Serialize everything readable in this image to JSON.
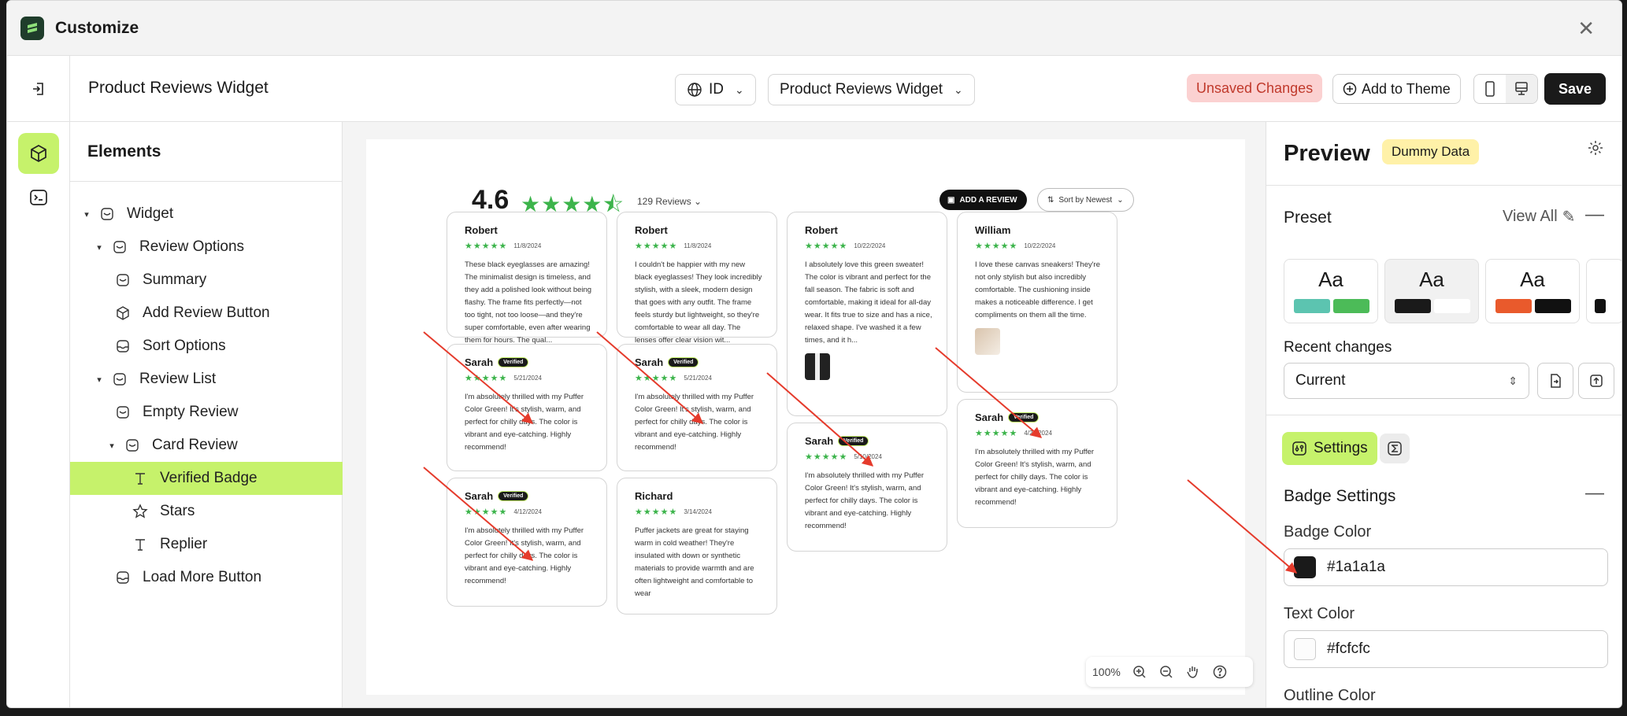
{
  "app": {
    "title": "Customize"
  },
  "toolbar": {
    "page_name": "Product Reviews Widget",
    "language": "ID",
    "widget_select": "Product Reviews Widget",
    "unsaved": "Unsaved Changes",
    "add_to_theme": "Add to Theme",
    "save": "Save"
  },
  "elements": {
    "title": "Elements",
    "tree": [
      {
        "label": "Widget"
      },
      {
        "label": "Review Options"
      },
      {
        "label": "Summary"
      },
      {
        "label": "Add Review Button"
      },
      {
        "label": "Sort Options"
      },
      {
        "label": "Review List"
      },
      {
        "label": "Empty Review"
      },
      {
        "label": "Card Review"
      },
      {
        "label": "Verified Badge"
      },
      {
        "label": "Stars"
      },
      {
        "label": "Replier"
      },
      {
        "label": "Load More Button"
      }
    ]
  },
  "canvas": {
    "rating": "4.6",
    "review_count": "129 Reviews",
    "add_review": "ADD A REVIEW",
    "sort": "Sort by Newest",
    "zoom": "100%",
    "cards": [
      {
        "name": "Robert",
        "date": "11/8/2024",
        "text": "These black eyeglasses are amazing! The minimalist design is timeless, and they add a polished look without being flashy. The frame fits perfectly—not too tight, not too loose—and they're super comfortable, even after wearing them for hours. The qual..."
      },
      {
        "name": "Sarah",
        "badge": "Verified",
        "date": "5/21/2024",
        "text": "I'm absolutely thrilled with my Puffer Color Green! It's stylish, warm, and perfect for chilly days. The color is vibrant and eye-catching. Highly recommend!"
      },
      {
        "name": "Sarah",
        "badge": "Verified",
        "date": "4/12/2024",
        "text": "I'm absolutely thrilled with my Puffer Color Green! It's stylish, warm, and perfect for chilly days. The color is vibrant and eye-catching. Highly recommend!"
      },
      {
        "name": "Robert",
        "date": "11/8/2024",
        "text": "I couldn't be happier with my new black eyeglasses! They look incredibly stylish, with a sleek, modern design that goes with any outfit. The frame feels sturdy but lightweight, so they're comfortable to wear all day. The lenses offer clear vision wit..."
      },
      {
        "name": "Sarah",
        "badge": "Verified",
        "date": "5/21/2024",
        "text": "I'm absolutely thrilled with my Puffer Color Green! It's stylish, warm, and perfect for chilly days. The color is vibrant and eye-catching. Highly recommend!"
      },
      {
        "name": "Richard",
        "date": "3/14/2024",
        "text": "Puffer jackets are great for staying warm in cold weather! They're insulated with down or synthetic materials to provide warmth and are often lightweight and comfortable to wear"
      },
      {
        "name": "Robert",
        "date": "10/22/2024",
        "text": "I absolutely love this green sweater! The color is vibrant and perfect for the fall season. The fabric is soft and comfortable, making it ideal for all-day wear. It fits true to size and has a nice, relaxed shape. I've washed it a few times, and it h..."
      },
      {
        "name": "Sarah",
        "badge": "Verified",
        "date": "5/10/2024",
        "text": "I'm absolutely thrilled with my Puffer Color Green! It's stylish, warm, and perfect for chilly days. The color is vibrant and eye-catching. Highly recommend!"
      },
      {
        "name": "William",
        "date": "10/22/2024",
        "text": "I love these canvas sneakers! They're not only stylish but also incredibly comfortable. The cushioning inside makes a noticeable difference. I get compliments on them all the time."
      },
      {
        "name": "Sarah",
        "badge": "Verified",
        "date": "4/23/2024",
        "text": "I'm absolutely thrilled with my Puffer Color Green! It's stylish, warm, and perfect for chilly days. The color is vibrant and eye-catching. Highly recommend!"
      }
    ]
  },
  "panel": {
    "title": "Preview",
    "dummy": "Dummy Data",
    "preset_label": "Preset",
    "view_all": "View All",
    "preset_aa": "Aa",
    "recent_label": "Recent changes",
    "recent_value": "Current",
    "settings_tab": "Settings",
    "section": "Badge Settings",
    "badge_color_label": "Badge Color",
    "badge_color": "#1a1a1a",
    "text_color_label": "Text Color",
    "text_color": "#fcfcfc",
    "outline_label": "Outline Color"
  },
  "colors": {
    "accent": "#c6f26b",
    "star": "#3cb44b",
    "arrow": "#e53b2c"
  }
}
